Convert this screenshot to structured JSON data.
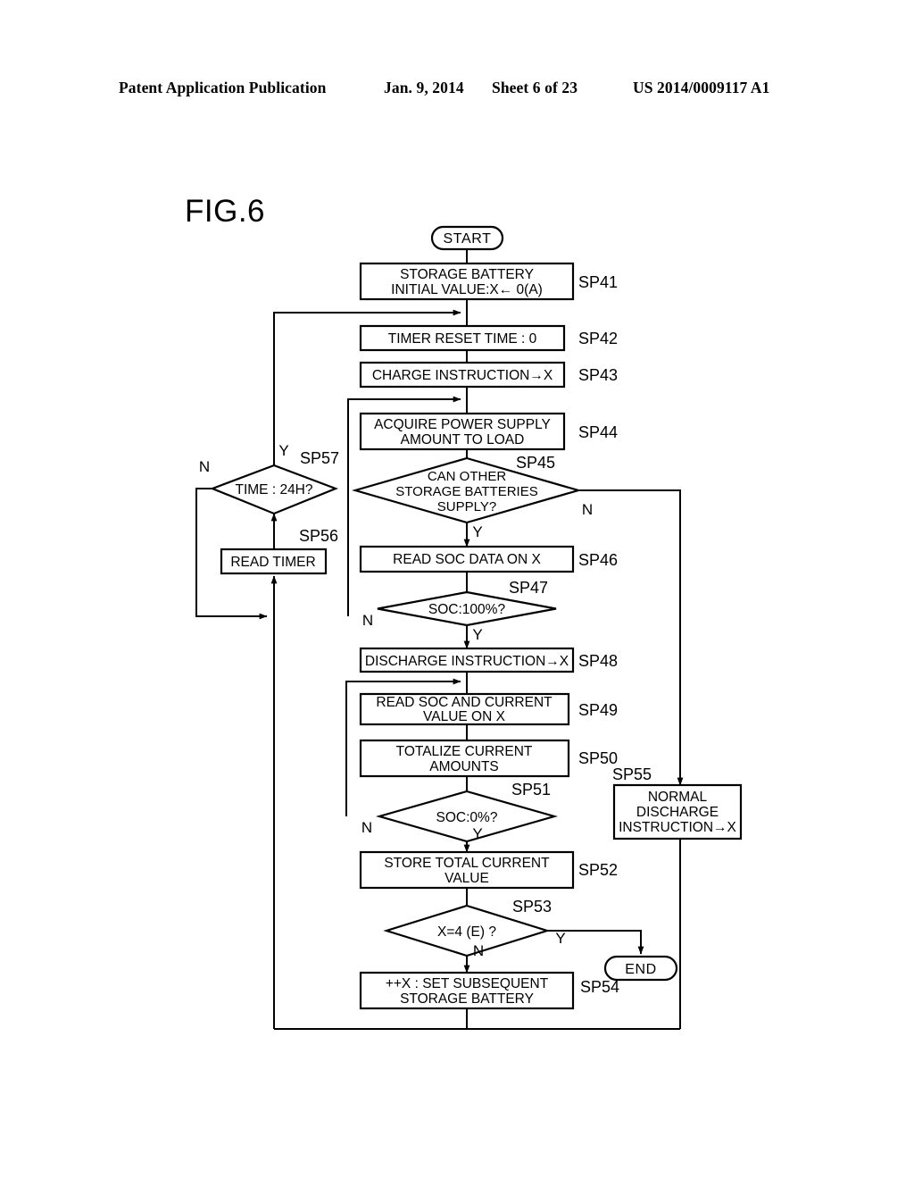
{
  "header": {
    "publication": "Patent Application Publication",
    "date": "Jan. 9, 2014",
    "sheet": "Sheet 6 of 23",
    "patent_number": "US 2014/0009117 A1"
  },
  "figure": {
    "title": "FIG.6"
  },
  "flowchart": {
    "start_label": "START",
    "end_label": "END",
    "nodes": [
      {
        "id": "SP41",
        "step": "SP41",
        "type": "process",
        "lines": [
          "STORAGE BATTERY",
          "INITIAL VALUE:X← 0(A)"
        ]
      },
      {
        "id": "SP42",
        "step": "SP42",
        "type": "process",
        "lines": [
          "TIMER RESET   TIME : 0"
        ]
      },
      {
        "id": "SP43",
        "step": "SP43",
        "type": "process",
        "lines": [
          "CHARGE INSTRUCTION→X"
        ]
      },
      {
        "id": "SP44",
        "step": "SP44",
        "type": "process",
        "lines": [
          "ACQUIRE POWER SUPPLY",
          "AMOUNT TO LOAD"
        ]
      },
      {
        "id": "SP45",
        "step": "SP45",
        "type": "decision",
        "lines": [
          "CAN OTHER",
          "STORAGE BATTERIES",
          "SUPPLY?"
        ]
      },
      {
        "id": "SP46",
        "step": "SP46",
        "type": "process",
        "lines": [
          "READ SOC DATA ON X"
        ]
      },
      {
        "id": "SP47",
        "step": "SP47",
        "type": "decision",
        "lines": [
          "SOC:100%?"
        ]
      },
      {
        "id": "SP48",
        "step": "SP48",
        "type": "process",
        "lines": [
          "DISCHARGE INSTRUCTION→X"
        ]
      },
      {
        "id": "SP49",
        "step": "SP49",
        "type": "process",
        "lines": [
          "READ SOC AND CURRENT",
          "VALUE ON X"
        ]
      },
      {
        "id": "SP50",
        "step": "SP50",
        "type": "process",
        "lines": [
          "TOTALIZE CURRENT",
          "AMOUNTS"
        ]
      },
      {
        "id": "SP51",
        "step": "SP51",
        "type": "decision",
        "lines": [
          "SOC:0%?"
        ]
      },
      {
        "id": "SP52",
        "step": "SP52",
        "type": "process",
        "lines": [
          "STORE TOTAL CURRENT",
          "VALUE"
        ]
      },
      {
        "id": "SP53",
        "step": "SP53",
        "type": "decision",
        "lines": [
          "X=4 (E) ?"
        ]
      },
      {
        "id": "SP54",
        "step": "SP54",
        "type": "process",
        "lines": [
          "++X : SET SUBSEQUENT",
          "STORAGE BATTERY"
        ]
      },
      {
        "id": "SP55",
        "step": "SP55",
        "type": "process",
        "lines": [
          "NORMAL",
          "DISCHARGE",
          "INSTRUCTION→X"
        ]
      },
      {
        "id": "SP56",
        "step": "SP56",
        "type": "process",
        "lines": [
          "READ TIMER"
        ]
      },
      {
        "id": "SP57",
        "step": "SP57",
        "type": "decision",
        "lines": [
          "TIME : 24H?"
        ]
      }
    ],
    "node_text": {
      "sp41_l1": "STORAGE BATTERY",
      "sp41_l2": "INITIAL VALUE:X← 0(A)",
      "sp42_l1": "TIMER RESET   TIME : 0",
      "sp43_l1": "CHARGE INSTRUCTION→X",
      "sp44_l1": "ACQUIRE POWER SUPPLY",
      "sp44_l2": "AMOUNT TO LOAD",
      "sp45_l1": "CAN OTHER",
      "sp45_l2": "STORAGE BATTERIES",
      "sp45_l3": "SUPPLY?",
      "sp46_l1": "READ SOC DATA ON X",
      "sp47_l1": "SOC:100%?",
      "sp48_l1": "DISCHARGE INSTRUCTION→X",
      "sp49_l1": "READ SOC AND CURRENT",
      "sp49_l2": "VALUE ON X",
      "sp50_l1": "TOTALIZE CURRENT",
      "sp50_l2": "AMOUNTS",
      "sp51_l1": "SOC:0%?",
      "sp52_l1": "STORE TOTAL CURRENT",
      "sp52_l2": "VALUE",
      "sp53_l1": "X=4 (E) ?",
      "sp54_l1": "++X : SET SUBSEQUENT",
      "sp54_l2": "STORAGE BATTERY",
      "sp55_l1": "NORMAL",
      "sp55_l2": "DISCHARGE",
      "sp55_l3": "INSTRUCTION→X",
      "sp56_l1": "READ TIMER",
      "sp57_l1": "TIME : 24H?"
    },
    "step_labels": {
      "sp41": "SP41",
      "sp42": "SP42",
      "sp43": "SP43",
      "sp44": "SP44",
      "sp45": "SP45",
      "sp46": "SP46",
      "sp47": "SP47",
      "sp48": "SP48",
      "sp49": "SP49",
      "sp50": "SP50",
      "sp51": "SP51",
      "sp52": "SP52",
      "sp53": "SP53",
      "sp54": "SP54",
      "sp55": "SP55",
      "sp56": "SP56",
      "sp57": "SP57"
    },
    "branch_labels": {
      "sp45_no": "N",
      "sp45_yes": "Y",
      "sp47_no": "N",
      "sp47_yes": "Y",
      "sp51_no": "N",
      "sp51_yes": "Y",
      "sp53_no": "N",
      "sp53_yes": "Y",
      "sp57_no": "N",
      "sp57_yes": "Y"
    },
    "edges": [
      {
        "from": "START",
        "to": "SP41"
      },
      {
        "from": "SP41",
        "to": "SP42"
      },
      {
        "from": "SP42",
        "to": "SP43"
      },
      {
        "from": "SP43",
        "to": "SP44"
      },
      {
        "from": "SP44",
        "to": "SP45"
      },
      {
        "from": "SP45",
        "to": "SP46",
        "label": "Y"
      },
      {
        "from": "SP45",
        "to": "SP55",
        "label": "N"
      },
      {
        "from": "SP46",
        "to": "SP47"
      },
      {
        "from": "SP47",
        "to": "SP48",
        "label": "Y"
      },
      {
        "from": "SP47",
        "to": "SP44",
        "label": "N"
      },
      {
        "from": "SP48",
        "to": "SP49"
      },
      {
        "from": "SP49",
        "to": "SP50"
      },
      {
        "from": "SP50",
        "to": "SP51"
      },
      {
        "from": "SP51",
        "to": "SP52",
        "label": "Y"
      },
      {
        "from": "SP51",
        "to": "SP49",
        "label": "N"
      },
      {
        "from": "SP52",
        "to": "SP53"
      },
      {
        "from": "SP53",
        "to": "END",
        "label": "Y"
      },
      {
        "from": "SP53",
        "to": "SP54",
        "label": "N"
      },
      {
        "from": "SP54",
        "to": "SP56"
      },
      {
        "from": "SP55",
        "to": "SP56"
      },
      {
        "from": "SP56",
        "to": "SP57"
      },
      {
        "from": "SP57",
        "to": "SP42",
        "label": "Y"
      },
      {
        "from": "SP57",
        "to": "SP56",
        "label": "N"
      }
    ]
  },
  "colors": {
    "ink": "#000000",
    "paper": "#ffffff"
  }
}
